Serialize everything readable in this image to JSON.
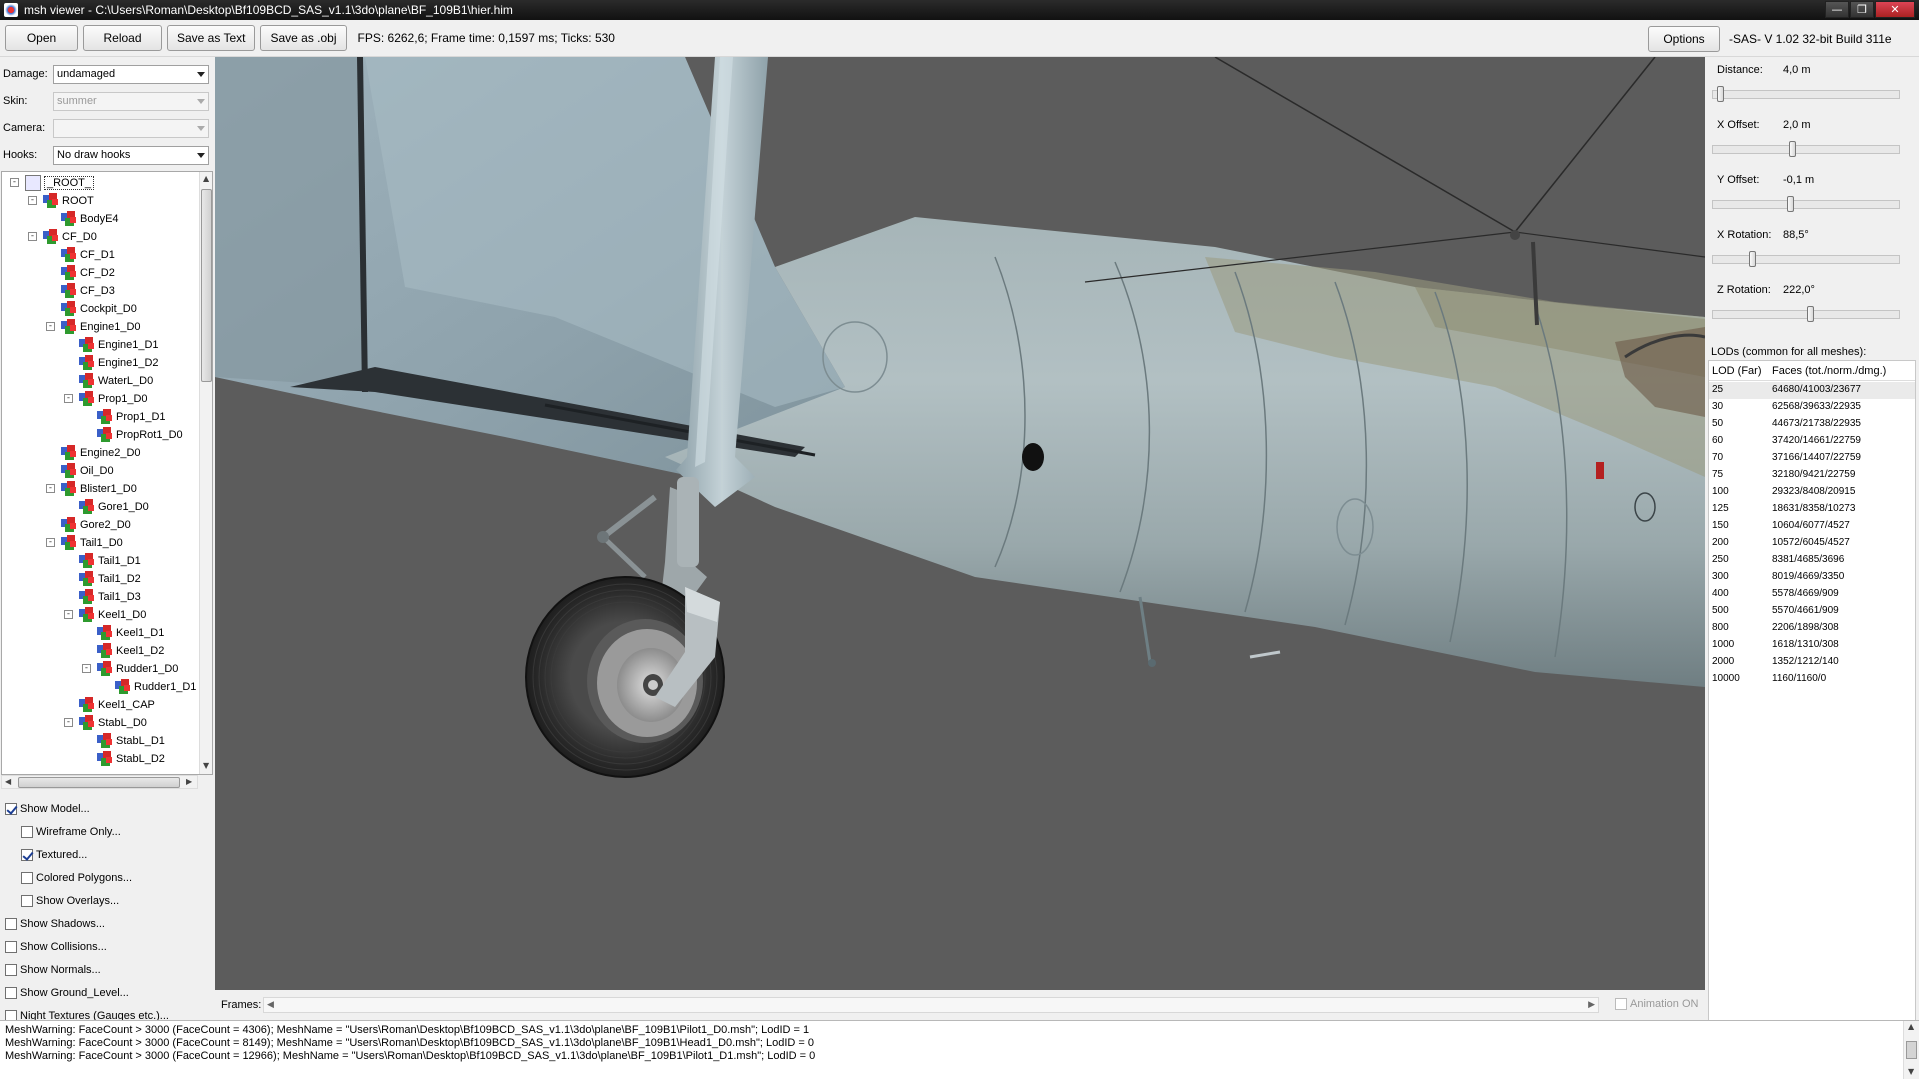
{
  "window": {
    "title": "msh viewer - C:\\Users\\Roman\\Desktop\\Bf109BCD_SAS_v1.1\\3do\\plane\\BF_109B1\\hier.him",
    "minimize": "—",
    "maximize": "❐",
    "close": "✕"
  },
  "toolbar": {
    "open": "Open",
    "reload": "Reload",
    "save_text": "Save as Text",
    "save_obj": "Save as .obj",
    "fps": "FPS: 6262,6; Frame time: 0,1597 ms; Ticks: 530",
    "options": "Options",
    "version": "-SAS- V 1.02  32-bit  Build 311e"
  },
  "left": {
    "damage_label": "Damage:",
    "damage_value": "undamaged",
    "skin_label": "Skin:",
    "skin_value": "summer",
    "camera_label": "Camera:",
    "camera_value": "",
    "hooks_label": "Hooks:",
    "hooks_value": "No draw hooks",
    "tree": [
      {
        "label": "_ROOT_",
        "depth": 0,
        "exp": "-"
      },
      {
        "label": "ROOT",
        "depth": 1,
        "exp": "-"
      },
      {
        "label": "BodyE4",
        "depth": 2,
        "exp": ""
      },
      {
        "label": "CF_D0",
        "depth": 1,
        "exp": "-"
      },
      {
        "label": "CF_D1",
        "depth": 2,
        "exp": ""
      },
      {
        "label": "CF_D2",
        "depth": 2,
        "exp": ""
      },
      {
        "label": "CF_D3",
        "depth": 2,
        "exp": ""
      },
      {
        "label": "Cockpit_D0",
        "depth": 2,
        "exp": ""
      },
      {
        "label": "Engine1_D0",
        "depth": 2,
        "exp": "-"
      },
      {
        "label": "Engine1_D1",
        "depth": 3,
        "exp": ""
      },
      {
        "label": "Engine1_D2",
        "depth": 3,
        "exp": ""
      },
      {
        "label": "WaterL_D0",
        "depth": 3,
        "exp": ""
      },
      {
        "label": "Prop1_D0",
        "depth": 3,
        "exp": "-"
      },
      {
        "label": "Prop1_D1",
        "depth": 4,
        "exp": ""
      },
      {
        "label": "PropRot1_D0",
        "depth": 4,
        "exp": ""
      },
      {
        "label": "Engine2_D0",
        "depth": 2,
        "exp": ""
      },
      {
        "label": "Oil_D0",
        "depth": 2,
        "exp": ""
      },
      {
        "label": "Blister1_D0",
        "depth": 2,
        "exp": "-"
      },
      {
        "label": "Gore1_D0",
        "depth": 3,
        "exp": ""
      },
      {
        "label": "Gore2_D0",
        "depth": 2,
        "exp": ""
      },
      {
        "label": "Tail1_D0",
        "depth": 2,
        "exp": "-"
      },
      {
        "label": "Tail1_D1",
        "depth": 3,
        "exp": ""
      },
      {
        "label": "Tail1_D2",
        "depth": 3,
        "exp": ""
      },
      {
        "label": "Tail1_D3",
        "depth": 3,
        "exp": ""
      },
      {
        "label": "Keel1_D0",
        "depth": 3,
        "exp": "-"
      },
      {
        "label": "Keel1_D1",
        "depth": 4,
        "exp": ""
      },
      {
        "label": "Keel1_D2",
        "depth": 4,
        "exp": ""
      },
      {
        "label": "Rudder1_D0",
        "depth": 4,
        "exp": "-"
      },
      {
        "label": "Rudder1_D1",
        "depth": 5,
        "exp": ""
      },
      {
        "label": "Keel1_CAP",
        "depth": 3,
        "exp": ""
      },
      {
        "label": "StabL_D0",
        "depth": 3,
        "exp": "-"
      },
      {
        "label": "StabL_D1",
        "depth": 4,
        "exp": ""
      },
      {
        "label": "StabL_D2",
        "depth": 4,
        "exp": ""
      }
    ],
    "options": [
      {
        "label": "Show Model...",
        "checked": true,
        "indent": 0
      },
      {
        "label": "Wireframe Only...",
        "checked": false,
        "indent": 1
      },
      {
        "label": "Textured...",
        "checked": true,
        "indent": 1
      },
      {
        "label": "Colored Polygons...",
        "checked": false,
        "indent": 1
      },
      {
        "label": "Show Overlays...",
        "checked": false,
        "indent": 1
      },
      {
        "label": "Show Shadows...",
        "checked": false,
        "indent": 0
      },
      {
        "label": "Show Collisions...",
        "checked": false,
        "indent": 0
      },
      {
        "label": "Show Normals...",
        "checked": false,
        "indent": 0
      },
      {
        "label": "Show Ground_Level...",
        "checked": false,
        "indent": 0
      },
      {
        "label": "Night Textures (Gauges etc.)...",
        "checked": false,
        "indent": 0
      }
    ]
  },
  "frames": {
    "label": "Frames:",
    "animation": "Animation ON"
  },
  "right": {
    "params": [
      {
        "label": "Distance:",
        "value": "4,0 m",
        "pos": 0.02
      },
      {
        "label": "X Offset:",
        "value": "2,0 m",
        "pos": 0.42
      },
      {
        "label": "Y Offset:",
        "value": "-0,1 m",
        "pos": 0.41
      },
      {
        "label": "X Rotation:",
        "value": "88,5°",
        "pos": 0.2
      },
      {
        "label": "Z Rotation:",
        "value": "222,0°",
        "pos": 0.52
      }
    ],
    "lod_title": "LODs (common for all meshes):",
    "lod_head": [
      "LOD (Far)",
      "Faces (tot./norm./dmg.)"
    ],
    "lods": [
      [
        "25",
        "64680/41003/23677"
      ],
      [
        "30",
        "62568/39633/22935"
      ],
      [
        "50",
        "44673/21738/22935"
      ],
      [
        "60",
        "37420/14661/22759"
      ],
      [
        "70",
        "37166/14407/22759"
      ],
      [
        "75",
        "32180/9421/22759"
      ],
      [
        "100",
        "29323/8408/20915"
      ],
      [
        "125",
        "18631/8358/10273"
      ],
      [
        "150",
        "10604/6077/4527"
      ],
      [
        "200",
        "10572/6045/4527"
      ],
      [
        "250",
        "8381/4685/3696"
      ],
      [
        "300",
        "8019/4669/3350"
      ],
      [
        "400",
        "5578/4669/909"
      ],
      [
        "500",
        "5570/4661/909"
      ],
      [
        "800",
        "2206/1898/308"
      ],
      [
        "1000",
        "1618/1310/308"
      ],
      [
        "2000",
        "1352/1212/140"
      ],
      [
        "10000",
        "1160/1160/0"
      ]
    ]
  },
  "log": [
    "MeshWarning: FaceCount > 3000 (FaceCount = 4306); MeshName = \"Users\\Roman\\Desktop\\Bf109BCD_SAS_v1.1\\3do\\plane\\BF_109B1\\Pilot1_D0.msh\"; LodID = 1",
    "MeshWarning: FaceCount > 3000 (FaceCount = 8149); MeshName = \"Users\\Roman\\Desktop\\Bf109BCD_SAS_v1.1\\3do\\plane\\BF_109B1\\Head1_D0.msh\"; LodID = 0",
    "MeshWarning: FaceCount > 3000 (FaceCount = 12966); MeshName = \"Users\\Roman\\Desktop\\Bf109BCD_SAS_v1.1\\3do\\plane\\BF_109B1\\Pilot1_D1.msh\"; LodID = 0"
  ]
}
